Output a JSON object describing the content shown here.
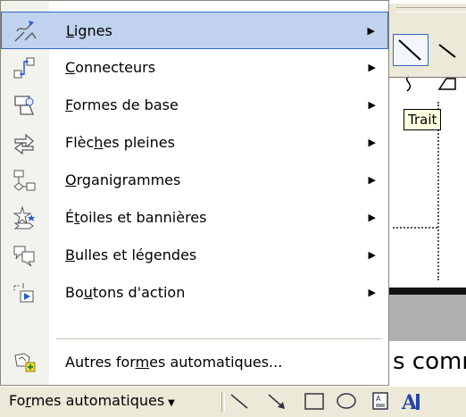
{
  "menu": {
    "items": [
      {
        "label_pre": "",
        "label_u": "L",
        "label_post": "ignes",
        "icon": "lines-icon",
        "submenu": true,
        "highlighted": true
      },
      {
        "label_pre": "",
        "label_u": "C",
        "label_post": "onnecteurs",
        "icon": "connectors-icon",
        "submenu": true
      },
      {
        "label_pre": "",
        "label_u": "F",
        "label_post": "ormes de base",
        "icon": "basic-shapes-icon",
        "submenu": true
      },
      {
        "label_pre": "Flèc",
        "label_u": "h",
        "label_post": "es pleines",
        "icon": "block-arrows-icon",
        "submenu": true
      },
      {
        "label_pre": "",
        "label_u": "O",
        "label_post": "rganigrammes",
        "icon": "flowchart-icon",
        "submenu": true
      },
      {
        "label_pre": "É",
        "label_u": "t",
        "label_post": "oiles et bannières",
        "icon": "stars-banners-icon",
        "submenu": true
      },
      {
        "label_pre": "",
        "label_u": "B",
        "label_post": "ulles et légendes",
        "icon": "callouts-icon",
        "submenu": true
      },
      {
        "label_pre": "Bo",
        "label_u": "u",
        "label_post": "tons d'action",
        "icon": "action-buttons-icon",
        "submenu": true
      },
      {
        "label_pre": "Autres for",
        "label_u": "m",
        "label_post": "es automatiques...",
        "icon": "more-autoshapes-icon",
        "submenu": false
      }
    ],
    "submenu_arrow": "▶"
  },
  "tooltip": {
    "text": "Trait"
  },
  "document": {
    "visible_text": "s comr"
  },
  "toolbar": {
    "autoshapes_pre": "Fo",
    "autoshapes_u": "r",
    "autoshapes_post": "mes automatiques",
    "dropdown_arrow": "▼",
    "tools": [
      "line-tool-icon",
      "arrow-tool-icon",
      "rectangle-tool-icon",
      "oval-tool-icon",
      "textbox-tool-icon",
      "wordart-tool-icon"
    ]
  },
  "colors": {
    "highlight_bg": "#c1d2ee",
    "highlight_border": "#316ac5",
    "toolbar_bg": "#ece9d8"
  }
}
